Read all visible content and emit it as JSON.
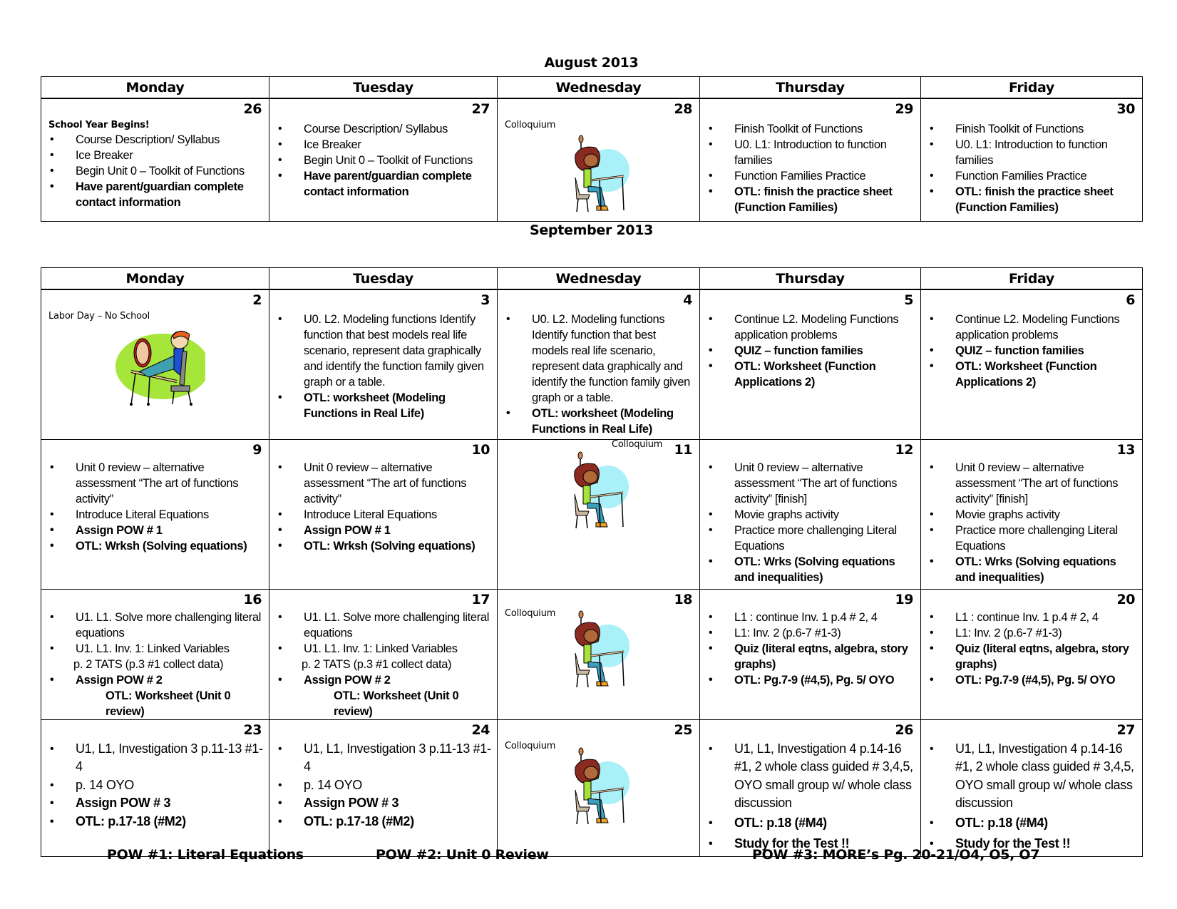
{
  "august": {
    "title": "August 2013",
    "weekdays": [
      "Monday",
      "Tuesday",
      "Wednesday",
      "Thursday",
      "Friday"
    ],
    "days": [
      {
        "day": "26",
        "note": "School Year Begins!",
        "note_bold": true,
        "items": [
          {
            "text": "Course Description/ Syllabus",
            "bold": false
          },
          {
            "text": "Ice Breaker",
            "bold": false
          },
          {
            "text": "Begin Unit 0 – Toolkit of Functions",
            "bold": false
          },
          {
            "text": "Have parent/guardian complete contact information",
            "bold": true
          }
        ]
      },
      {
        "day": "27",
        "items": [
          {
            "text": "Course Description/ Syllabus",
            "bold": false
          },
          {
            "text": "Ice Breaker",
            "bold": false
          },
          {
            "text": "Begin Unit 0 – Toolkit of Functions",
            "bold": false
          },
          {
            "text": "Have parent/guardian complete contact information",
            "bold": true
          }
        ]
      },
      {
        "day": "28",
        "note": "Colloquium",
        "image": "student-at-desk-illustration"
      },
      {
        "day": "29",
        "items": [
          {
            "text": "Finish Toolkit of Functions",
            "bold": false
          },
          {
            "text": "U0. L1: Introduction to function families",
            "bold": false
          },
          {
            "text": "Function Families Practice",
            "bold": false
          },
          {
            "text": "OTL: finish the practice sheet (Function Families)",
            "bold": true
          }
        ]
      },
      {
        "day": "30",
        "items": [
          {
            "text": "Finish Toolkit of Functions",
            "bold": false
          },
          {
            "text": "U0. L1: Introduction to function families",
            "bold": false
          },
          {
            "text": "Function Families Practice",
            "bold": false
          },
          {
            "text": "OTL: finish the practice sheet (Function Families)",
            "bold": true
          }
        ]
      }
    ]
  },
  "september": {
    "title": "September 2013",
    "weekdays": [
      "Monday",
      "Tuesday",
      "Wednesday",
      "Thursday",
      "Friday"
    ],
    "weeks": [
      [
        {
          "day": "2",
          "note": "Labor Day – No School",
          "image": "relaxing-student-illustration"
        },
        {
          "day": "3",
          "items": [
            {
              "text": "U0. L2. Modeling functions Identify function that best models real life scenario, represent data graphically and identify the function family given graph or a table.",
              "bold": false
            },
            {
              "text": "OTL: worksheet (Modeling Functions in Real Life)",
              "bold": true
            }
          ]
        },
        {
          "day": "4",
          "items": [
            {
              "text": "U0. L2. Modeling functions Identify function that best models real life scenario, represent data graphically and identify the function family given graph or a table.",
              "bold": false
            },
            {
              "text": "OTL: worksheet (Modeling Functions in Real Life)",
              "bold": true
            }
          ]
        },
        {
          "day": "5",
          "items": [
            {
              "text": "Continue L2. Modeling Functions application problems",
              "bold": false
            },
            {
              "text": "QUIZ – function families",
              "bold": true
            },
            {
              "text": "OTL: Worksheet (Function Applications 2)",
              "bold": true
            }
          ]
        },
        {
          "day": "6",
          "items": [
            {
              "text": "Continue L2. Modeling Functions application problems",
              "bold": false
            },
            {
              "text": "QUIZ – function families",
              "bold": true
            },
            {
              "text": "OTL: Worksheet (Function Applications 2)",
              "bold": true
            }
          ]
        }
      ],
      [
        {
          "day": "9",
          "items": [
            {
              "text": "Unit 0 review –  alternative assessment “The art of functions activity”",
              "bold": false
            },
            {
              "text": "Introduce Literal Equations",
              "bold": false
            },
            {
              "text": "Assign POW # 1",
              "bold": true
            },
            {
              "text": "OTL: Wrksh (Solving equations)",
              "bold": true
            }
          ]
        },
        {
          "day": "10",
          "items": [
            {
              "text": "Unit 0 review –  alternative assessment “The art of functions activity”",
              "bold": false
            },
            {
              "text": "Introduce Literal Equations",
              "bold": false
            },
            {
              "text": "Assign POW # 1",
              "bold": true
            },
            {
              "text": "OTL: Wrksh (Solving equations)",
              "bold": true
            }
          ]
        },
        {
          "day": "11",
          "note": "Colloquium",
          "image": "student-at-desk-illustration"
        },
        {
          "day": "12",
          "items": [
            {
              "text": "Unit 0 review –  alternative assessment “The art of functions activity” [finish]",
              "bold": false
            },
            {
              "text": "Movie graphs activity",
              "bold": false
            },
            {
              "text": "Practice more challenging Literal Equations",
              "bold": false
            },
            {
              "text": "OTL: Wrks (Solving equations and inequalities)",
              "bold": true
            }
          ]
        },
        {
          "day": "13",
          "items": [
            {
              "text": "Unit 0 review –  alternative assessment “The art of functions activity” [finish]",
              "bold": false
            },
            {
              "text": "Movie graphs activity",
              "bold": false
            },
            {
              "text": "Practice more challenging Literal Equations",
              "bold": false
            },
            {
              "text": "OTL: Wrks (Solving equations and inequalities)",
              "bold": true
            }
          ]
        }
      ],
      [
        {
          "day": "16",
          "items": [
            {
              "text": "U1. L1. Solve more challenging literal equations",
              "bold": false
            },
            {
              "text": "U1. L1. Inv. 1: Linked Variables",
              "bold": false
            },
            {
              "text": "p. 2 TATS (p.3 #1 collect data)",
              "bold": false,
              "continuation": true
            },
            {
              "text": "Assign POW #  2",
              "bold": true
            },
            {
              "text": "OTL: Worksheet (Unit 0 review)",
              "bold": true,
              "indented": true
            }
          ]
        },
        {
          "day": "17",
          "items": [
            {
              "text": "U1. L1. Solve more challenging literal equations",
              "bold": false
            },
            {
              "text": "U1. L1. Inv. 1: Linked Variables",
              "bold": false
            },
            {
              "text": "p. 2 TATS (p.3 #1 collect data)",
              "bold": false,
              "continuation": true
            },
            {
              "text": "Assign POW #  2",
              "bold": true
            },
            {
              "text": "OTL: Worksheet (Unit 0 review)",
              "bold": true,
              "indented": true
            }
          ]
        },
        {
          "day": "18",
          "note": "Colloquium",
          "image": "student-at-desk-illustration"
        },
        {
          "day": "19",
          "items": [
            {
              "text": "L1 : continue Inv. 1 p.4 # 2, 4",
              "bold": false
            },
            {
              "text": "L1: Inv. 2 (p.6-7 #1-3)",
              "bold": false
            },
            {
              "text": "Quiz (literal eqtns, algebra, story graphs)",
              "bold": true
            },
            {
              "text": "OTL: Pg.7-9 (#4,5), Pg. 5/ OYO",
              "bold": true
            }
          ]
        },
        {
          "day": "20",
          "items": [
            {
              "text": "L1 : continue Inv. 1 p.4 # 2, 4",
              "bold": false
            },
            {
              "text": "L1: Inv. 2 (p.6-7 #1-3)",
              "bold": false
            },
            {
              "text": "Quiz (literal eqtns, algebra, story graphs)",
              "bold": true
            },
            {
              "text": "OTL: Pg.7-9 (#4,5), Pg. 5/ OYO",
              "bold": true
            }
          ]
        }
      ],
      [
        {
          "day": "23",
          "items": [
            {
              "text": "U1, L1, Investigation 3   p.11-13 #1-4",
              "bold": false
            },
            {
              "text": "p. 14 OYO",
              "bold": false
            },
            {
              "text": "Assign POW # 3",
              "bold": true
            },
            {
              "text": "OTL: p.17-18 (#M2)",
              "bold": true
            }
          ]
        },
        {
          "day": "24",
          "items": [
            {
              "text": "U1, L1, Investigation 3   p.11-13 #1-4",
              "bold": false
            },
            {
              "text": "p. 14 OYO",
              "bold": false
            },
            {
              "text": "Assign POW # 3",
              "bold": true
            },
            {
              "text": "OTL: p.17-18 (#M2)",
              "bold": true
            }
          ]
        },
        {
          "day": "25",
          "note": "Colloquium",
          "image": "student-at-desk-illustration"
        },
        {
          "day": "26",
          "items": [
            {
              "text": "U1, L1, Investigation 4   p.14-16 #1, 2 whole class guided # 3,4,5, OYO small group w/ whole class discussion",
              "bold": false
            },
            {
              "text": "OTL: p.18 (#M4)",
              "bold": true
            },
            {
              "text": "Study for the Test !!",
              "bold": true
            }
          ]
        },
        {
          "day": "27",
          "items": [
            {
              "text": "U1, L1, Investigation 4   p.14-16 #1, 2 whole class guided # 3,4,5, OYO small group w/ whole class discussion",
              "bold": false
            },
            {
              "text": "OTL: p.18 (#M4)",
              "bold": true
            },
            {
              "text": "Study for the Test !!",
              "bold": true
            }
          ]
        }
      ]
    ]
  },
  "footer": {
    "pow1": "POW #1: Literal Equations",
    "pow2": "POW #2: Unit 0 Review",
    "pow3": "POW #3: MORE’s Pg. 20-21/O4, O5, O7"
  }
}
